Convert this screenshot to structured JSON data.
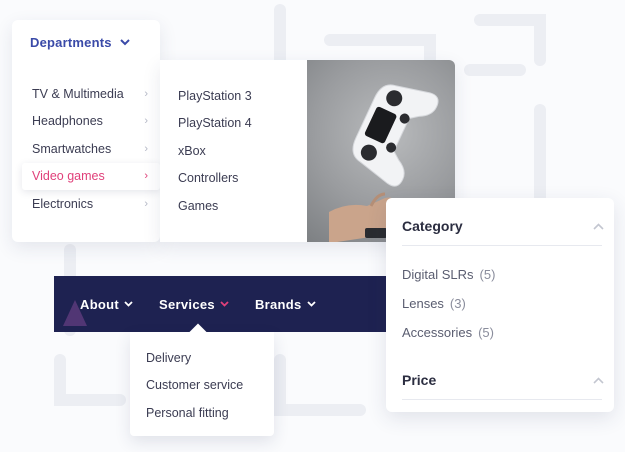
{
  "departments": {
    "title": "Departments",
    "items": [
      {
        "label": "TV & Multimedia"
      },
      {
        "label": "Headphones"
      },
      {
        "label": "Smartwatches"
      },
      {
        "label": "Video games",
        "active": true
      },
      {
        "label": "Electronics"
      }
    ],
    "submenu": [
      "PlayStation 3",
      "PlayStation 4",
      "xBox",
      "Controllers",
      "Games"
    ]
  },
  "navbar": {
    "items": [
      {
        "label": "About"
      },
      {
        "label": "Services",
        "active": true
      },
      {
        "label": "Brands"
      }
    ],
    "services_dropdown": [
      "Delivery",
      "Customer service",
      "Personal fitting"
    ]
  },
  "filters": {
    "category": {
      "title": "Category",
      "options": [
        {
          "label": "Digital SLRs",
          "count": "(5)"
        },
        {
          "label": "Lenses",
          "count": "(3)"
        },
        {
          "label": "Accessories",
          "count": "(5)"
        }
      ]
    },
    "price": {
      "title": "Price"
    }
  },
  "icons": {
    "chevron_down": "chevron-down-icon",
    "chevron_right": "chevron-right-icon",
    "chevron_up": "chevron-up-icon",
    "controller_photo": "game-controller-photo"
  },
  "colors": {
    "accent": "#e0407a",
    "brand_blue": "#3a4aa8",
    "navbar_bg": "#1e2251"
  }
}
